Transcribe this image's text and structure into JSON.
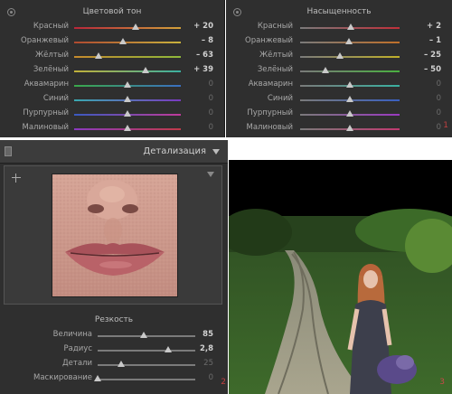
{
  "hue": {
    "title": "Цветовой тон",
    "rows": [
      {
        "label": "Красный",
        "value": "+ 20",
        "pos": 0.58,
        "colors": [
          "#b8263a",
          "#d2a13a"
        ]
      },
      {
        "label": "Оранжевый",
        "value": "– 8",
        "pos": 0.46,
        "colors": [
          "#b04a30",
          "#c9b23c"
        ]
      },
      {
        "label": "Жёлтый",
        "value": "– 63",
        "pos": 0.23,
        "colors": [
          "#c58a2d",
          "#8fb83a"
        ]
      },
      {
        "label": "Зелёный",
        "value": "+ 39",
        "pos": 0.67,
        "colors": [
          "#c2b13a",
          "#3ab0a1"
        ]
      },
      {
        "label": "Аквамарин",
        "value": "0",
        "pos": 0.5,
        "colors": [
          "#3aa84a",
          "#3a6fc0"
        ]
      },
      {
        "label": "Синий",
        "value": "0",
        "pos": 0.5,
        "colors": [
          "#3aa8b0",
          "#7a3ac0"
        ]
      },
      {
        "label": "Пурпурный",
        "value": "0",
        "pos": 0.5,
        "colors": [
          "#3a5ac0",
          "#c03a9a"
        ]
      },
      {
        "label": "Малиновый",
        "value": "0",
        "pos": 0.5,
        "colors": [
          "#8a3ac0",
          "#c03a4a"
        ]
      }
    ]
  },
  "saturation": {
    "title": "Насыщенность",
    "rows": [
      {
        "label": "Красный",
        "value": "+ 2",
        "pos": 0.51,
        "colors": [
          "#7a7a7a",
          "#c0303a"
        ]
      },
      {
        "label": "Оранжевый",
        "value": "– 1",
        "pos": 0.49,
        "colors": [
          "#7a7a7a",
          "#c0702a"
        ]
      },
      {
        "label": "Жёлтый",
        "value": "– 25",
        "pos": 0.4,
        "colors": [
          "#7a7a7a",
          "#c0b02a"
        ]
      },
      {
        "label": "Зелёный",
        "value": "– 50",
        "pos": 0.25,
        "colors": [
          "#7a7a7a",
          "#4ab040"
        ]
      },
      {
        "label": "Аквамарин",
        "value": "0",
        "pos": 0.5,
        "colors": [
          "#7a7a7a",
          "#3ab0a0"
        ]
      },
      {
        "label": "Синий",
        "value": "0",
        "pos": 0.5,
        "colors": [
          "#7a7a7a",
          "#3a60c0"
        ]
      },
      {
        "label": "Пурпурный",
        "value": "0",
        "pos": 0.5,
        "colors": [
          "#7a7a7a",
          "#9a3ac0"
        ]
      },
      {
        "label": "Малиновый",
        "value": "0",
        "pos": 0.5,
        "colors": [
          "#7a7a7a",
          "#c03a70"
        ]
      }
    ],
    "marker": "1"
  },
  "detail": {
    "title": "Детализация",
    "sharpening_title": "Резкость",
    "rows": [
      {
        "label": "Величина",
        "value": "85",
        "pos": 0.47,
        "dim": false
      },
      {
        "label": "Радиус",
        "value": "2,8",
        "pos": 0.72,
        "dim": false
      },
      {
        "label": "Детали",
        "value": "25",
        "pos": 0.24,
        "dim": true
      },
      {
        "label": "Маскирование",
        "value": "0",
        "pos": 0.0,
        "dim": true
      }
    ],
    "marker": "2"
  },
  "photo": {
    "marker": "3"
  }
}
